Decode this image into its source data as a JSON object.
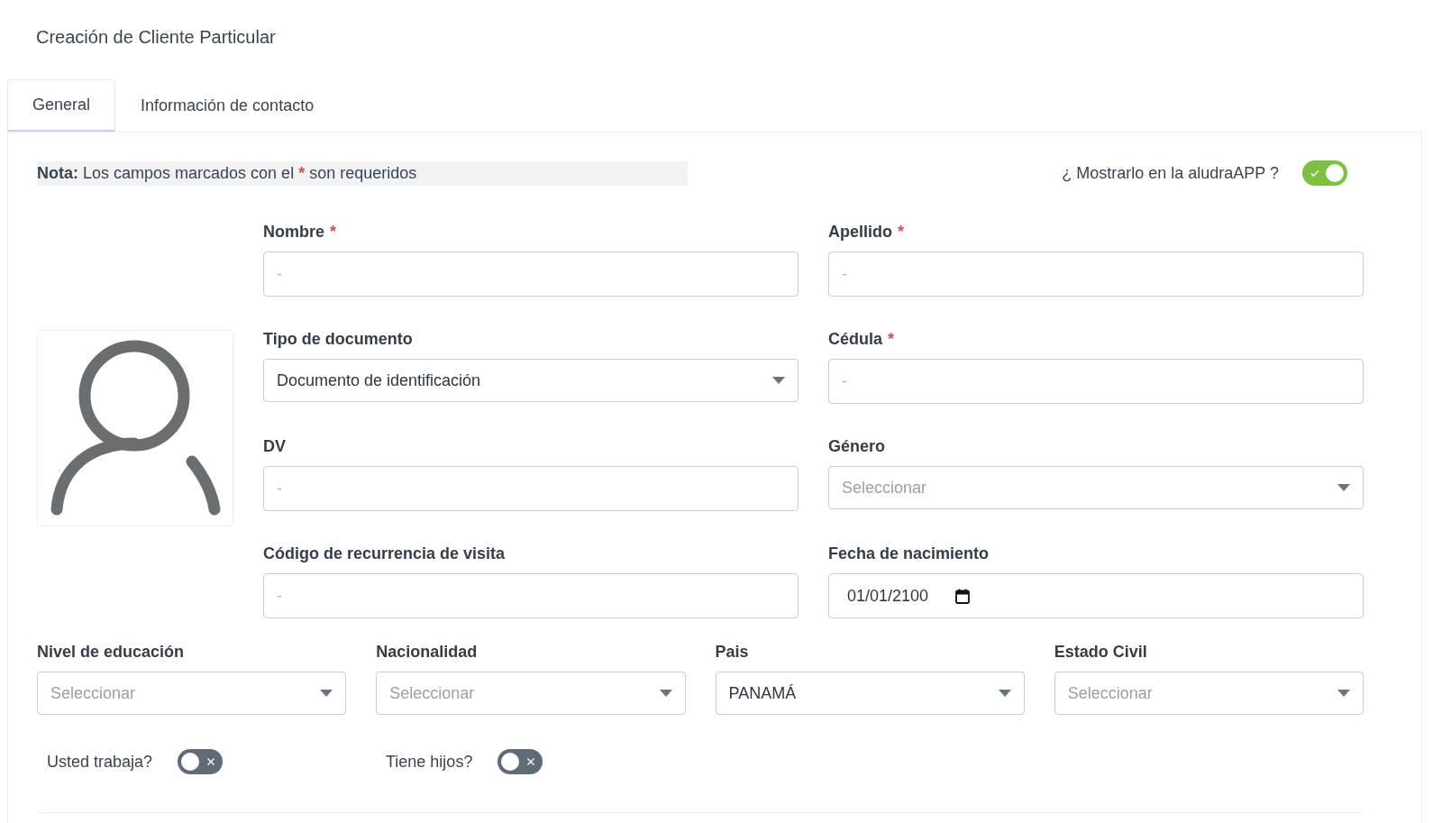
{
  "page_title": "Creación de Cliente Particular",
  "tabs": [
    {
      "label": "General",
      "selected": true
    },
    {
      "label": "Información de contacto",
      "selected": false
    }
  ],
  "required_mark": "*",
  "note": {
    "lead": "Nota:",
    "text_before": "Los campos marcados con el",
    "text_after": "son requeridos"
  },
  "app_toggle": {
    "label": "¿ Mostrarlo en la aludraAPP ?",
    "on": true
  },
  "fields": [
    {
      "label": "Nombre",
      "required": true,
      "kind": "text",
      "placeholder": "-"
    },
    {
      "label": "Apellido",
      "required": true,
      "kind": "text",
      "placeholder": "-"
    },
    {
      "label": "Tipo de documento",
      "required": false,
      "kind": "select",
      "value": "Documento de identificación"
    },
    {
      "label": "Cédula",
      "required": true,
      "kind": "text",
      "placeholder": "-"
    },
    {
      "label": "DV",
      "required": false,
      "kind": "text",
      "placeholder": "-"
    },
    {
      "label": "Género",
      "required": false,
      "kind": "select",
      "placeholder": "Seleccionar"
    },
    {
      "label": "Código de recurrencia de visita",
      "required": false,
      "kind": "text",
      "placeholder": "-"
    },
    {
      "label": "Fecha de nacimiento",
      "required": false,
      "kind": "date",
      "value": "01/01/2100"
    }
  ],
  "bottom_fields": [
    {
      "label": "Nivel de educación",
      "required": false,
      "kind": "select",
      "placeholder": "Seleccionar"
    },
    {
      "label": "Nacionalidad",
      "required": false,
      "kind": "select",
      "placeholder": "Seleccionar"
    },
    {
      "label": "Pais",
      "required": false,
      "kind": "select",
      "value": "PANAMÁ"
    },
    {
      "label": "Estado Civil",
      "required": false,
      "kind": "select",
      "placeholder": "Seleccionar"
    }
  ],
  "toggles": [
    {
      "label": "Usted trabaja?",
      "on": false
    },
    {
      "label": "Tiene hijos?",
      "on": false
    }
  ]
}
